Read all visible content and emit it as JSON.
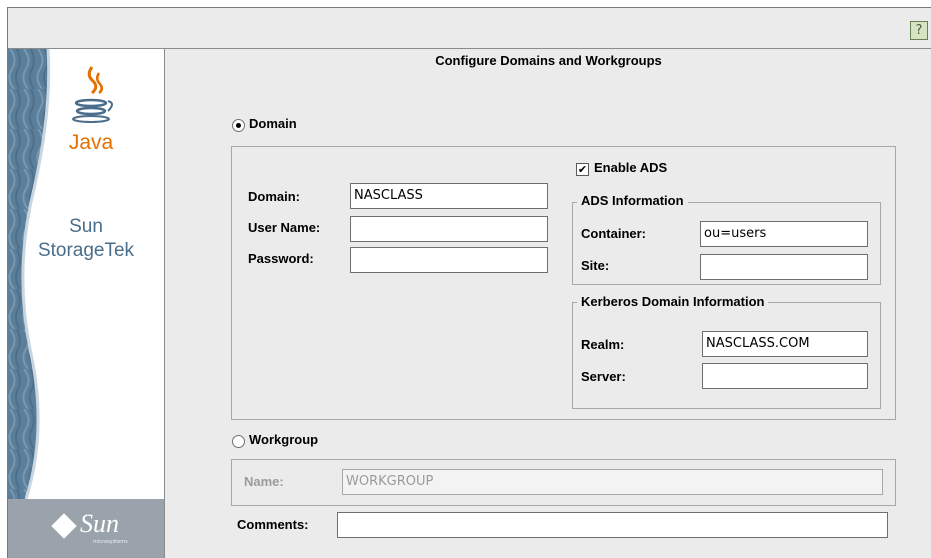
{
  "toolbar": {
    "help_icon": "question-mark-icon",
    "help_label": "?"
  },
  "sidebar": {
    "java_logo_text": "Java",
    "product_line1": "Sun",
    "product_line2": "StorageTek",
    "vendor_logo_text": "Sun",
    "vendor_sub_text": "microsystems"
  },
  "page": {
    "title": "Configure Domains and Workgroups"
  },
  "domain": {
    "radio_label": "Domain",
    "selected": true,
    "domain_label": "Domain:",
    "domain_value": "NASCLASS",
    "username_label": "User Name:",
    "username_value": "",
    "password_label": "Password:",
    "password_value": ""
  },
  "ads": {
    "enable_label": "Enable ADS",
    "enabled": true,
    "check_mark": "✔",
    "info_title": "ADS Information",
    "container_label": "Container:",
    "container_value": "ou=users",
    "site_label": "Site:",
    "site_value": ""
  },
  "kerberos": {
    "title": "Kerberos Domain Information",
    "realm_label": "Realm:",
    "realm_value": "NASCLASS.COM",
    "server_label": "Server:",
    "server_value": ""
  },
  "workgroup": {
    "radio_label": "Workgroup",
    "selected": false,
    "name_label": "Name:",
    "name_value": "WORKGROUP"
  },
  "comments": {
    "label": "Comments:",
    "value": ""
  },
  "colors": {
    "java_orange": "#e76f00",
    "sidebar_blue": "#5b7f9a",
    "panel_bg": "#ebebeb"
  }
}
